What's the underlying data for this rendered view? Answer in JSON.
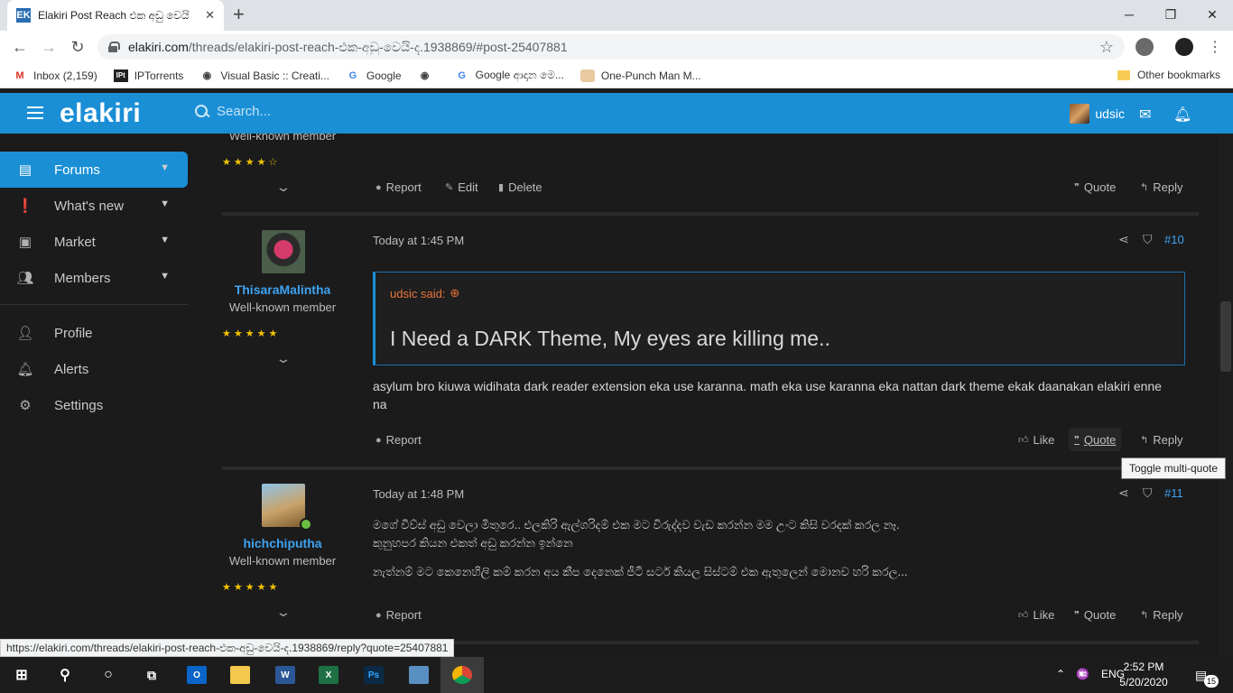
{
  "browser": {
    "tab_title": "Elakiri Post Reach එක අඩු වෙයි",
    "tab_favicon": "EK",
    "url_host": "elakiri.com",
    "url_path": "/threads/elakiri-post-reach-එක-අඩු-වෙයි-ද.1938869/#post-25407881",
    "bookmarks": [
      {
        "icon": "gmail-icon",
        "label": "Inbox (2,159)"
      },
      {
        "icon": "iptorrents-icon",
        "label": "IPTorrents"
      },
      {
        "icon": "globe-icon",
        "label": "Visual Basic :: Creati..."
      },
      {
        "icon": "google-icon",
        "label": "Google"
      },
      {
        "icon": "globe-icon",
        "label": ""
      },
      {
        "icon": "google-icon",
        "label": "Google ආදාන මෙ..."
      },
      {
        "icon": "anime-icon",
        "label": "One-Punch Man M..."
      }
    ],
    "other_bookmarks": "Other bookmarks",
    "status_url": "https://elakiri.com/threads/elakiri-post-reach-එක-අඩු-වෙයි-ද.1938869/reply?quote=25407881",
    "tooltip": "Toggle multi-quote"
  },
  "site": {
    "logo": "elakiri",
    "search_placeholder": "Search...",
    "username": "udsic",
    "accent": "#1a8fd6"
  },
  "sidebar": {
    "items": [
      {
        "label": "Forums",
        "icon": "forums-icon",
        "active": true,
        "chevron": true
      },
      {
        "label": "What's new",
        "icon": "whats-new-icon",
        "chevron": true
      },
      {
        "label": "Market",
        "icon": "market-icon",
        "chevron": true
      },
      {
        "label": "Members",
        "icon": "members-icon",
        "chevron": true
      },
      {
        "label": "Profile",
        "icon": "profile-icon"
      },
      {
        "label": "Alerts",
        "icon": "alerts-icon"
      },
      {
        "label": "Settings",
        "icon": "settings-icon"
      }
    ]
  },
  "posts": {
    "prev": {
      "user_title": "Well-known member",
      "actions": {
        "report": "Report",
        "edit": "Edit",
        "delete": "Delete",
        "quote": "Quote",
        "reply": "Reply"
      }
    },
    "post10": {
      "username": "ThisaraMalintha",
      "user_title": "Well-known member",
      "date": "Today at 1:45 PM",
      "number": "#10",
      "quote_author": "udsic said:",
      "quote_text": "I Need a DARK Theme, My eyes are killing me..",
      "body_line1": "asylum bro kiuwa widihata dark reader extension eka use karanna. math eka use karanna eka nattan dark theme ekak daanakan elakiri enne",
      "body_line2": "na",
      "actions": {
        "report": "Report",
        "like": "Like",
        "quote": "Quote",
        "reply": "Reply"
      }
    },
    "post11": {
      "username": "hichchiputha",
      "user_title": "Well-known member",
      "date": "Today at 1:48 PM",
      "number": "#11",
      "body_line1": "මගේ වීව්ස් අඩු වෙලා මිතුරෙ.. එලකිරි ඇල්ගරිදම් එක මට විරුද්දව වැඩ කරන්න මම උංට කිසි වරදක් කරල නෑ.",
      "body_line2": "කුනුහපර කියන එකත් අඩු කරන්න ඉන්නෙ",
      "body_line3": "නැත්නම් මට කෙනෙහිලි කම් කරන අය කීප දෙනෙක් ජීටී සර්ට කියල සිස්ටම් එක ඇතුලෙන් මොනව හරි කරල...",
      "actions": {
        "report": "Report",
        "like": "Like",
        "quote": "Quote",
        "reply": "Reply"
      }
    }
  },
  "taskbar": {
    "language": "ENG",
    "time": "2:52 PM",
    "date": "5/20/2020",
    "notifications": "15"
  }
}
